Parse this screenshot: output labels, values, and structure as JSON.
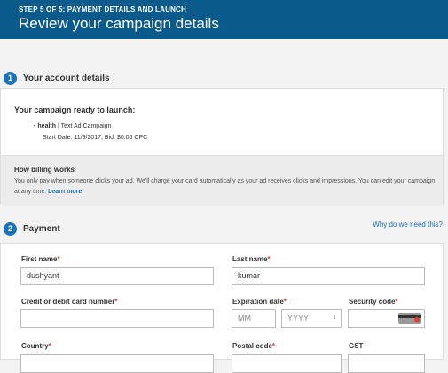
{
  "header": {
    "step": "STEP 5 OF 5: PAYMENT DETAILS AND LAUNCH",
    "title": "Review your campaign details"
  },
  "account": {
    "number": "1",
    "title": "Your account details",
    "ready_title": "Your campaign ready to launch:",
    "campaign_name": "health",
    "campaign_type": " | Text Ad Campaign",
    "start_date_text": "Start Date: 11/9/2017, Bid: $0.00 CPC",
    "billing_title": "How billing works",
    "billing_text": "You only pay when someone clicks your ad. We'll charge your card automatically as your ad receives clicks and impressions. You can edit your campaign at any time.",
    "learn_more": "Learn more"
  },
  "payment": {
    "number": "2",
    "title": "Payment",
    "why_link": "Why do we need this?",
    "first_name_label": "First name",
    "first_name_value": "dushyant",
    "last_name_label": "Last name",
    "last_name_value": "kumar",
    "card_label": "Credit or debit card number",
    "card_value": "",
    "expiration_label": "Expiration date",
    "month_placeholder": "MM",
    "year_selected": "YYYY",
    "security_label": "Security code",
    "country_label": "Country",
    "postal_label": "Postal code",
    "gst_label": "GST",
    "required_marker": "*"
  },
  "icons": {
    "card": "card-back-icon",
    "chevron": "chevron-updown-icon"
  },
  "colors": {
    "header_bg": "#0b5a8c",
    "accent": "#1a73b8",
    "required": "#e53935"
  }
}
